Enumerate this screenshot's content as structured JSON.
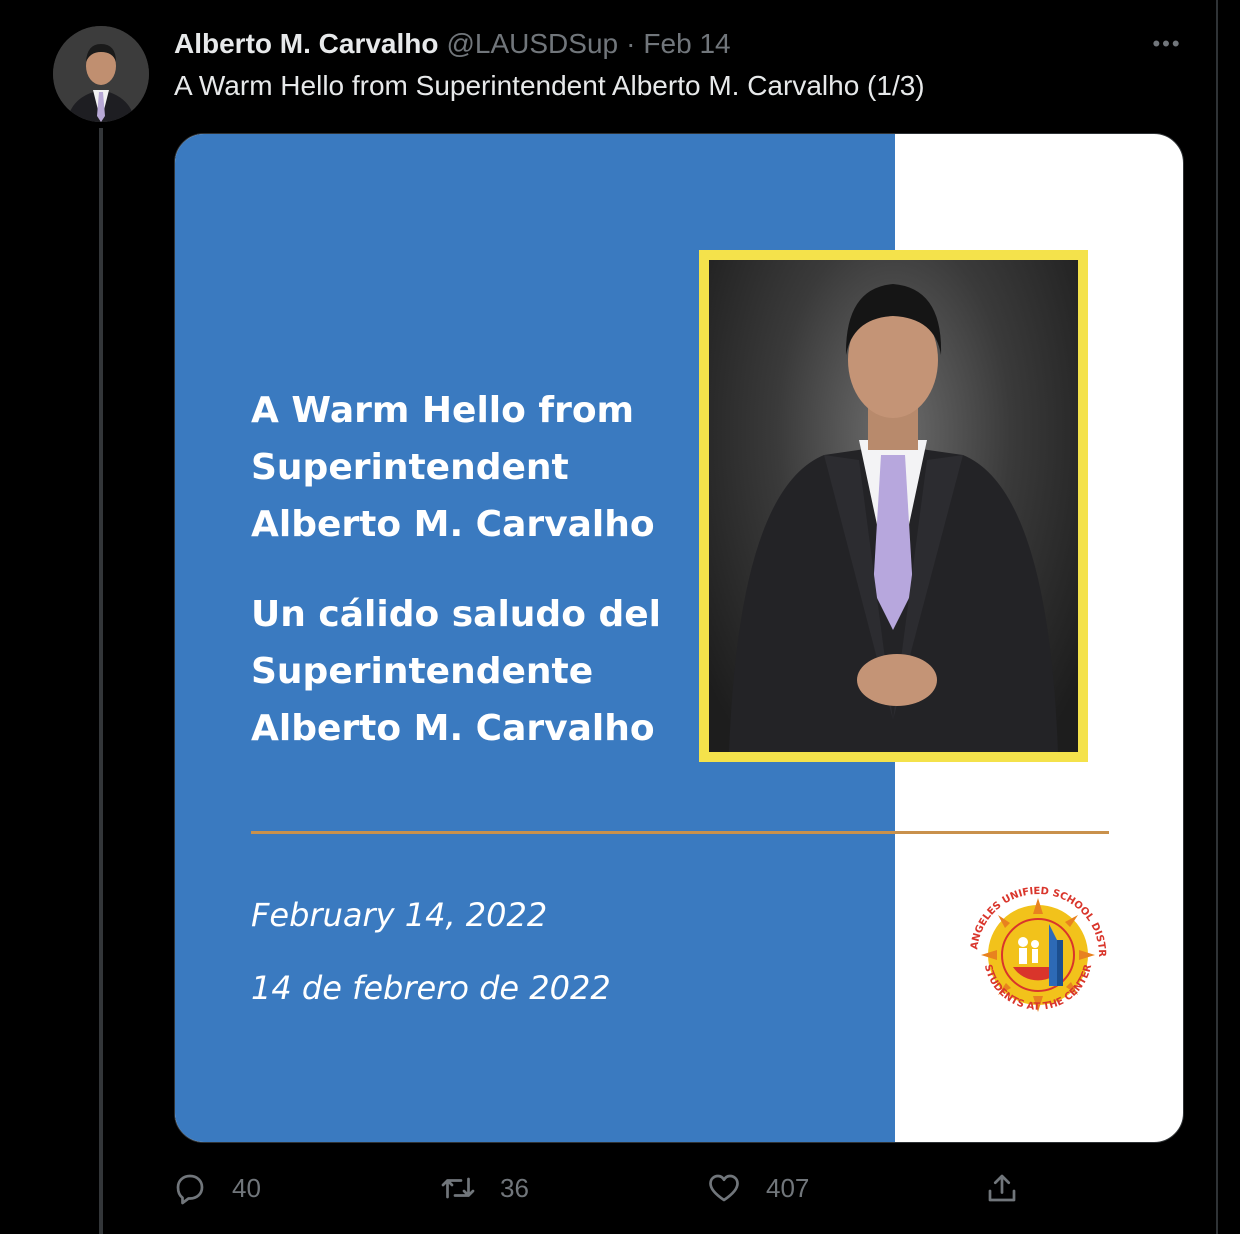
{
  "tweet": {
    "author_name": "Alberto M. Carvalho",
    "handle": "@LAUSDSup",
    "separator": "·",
    "date": "Feb 14",
    "more_label": "•••",
    "text": "A Warm Hello from Superintendent Alberto M. Carvalho (1/3)"
  },
  "media_card": {
    "english_lines": [
      "A Warm Hello from",
      "Superintendent",
      "Alberto M. Carvalho"
    ],
    "spanish_lines": [
      "Un cálido saludo del",
      "Superintendente",
      "Alberto M. Carvalho"
    ],
    "date_english": "February 14, 2022",
    "date_spanish": "14 de febrero de 2022",
    "logo_ring_top": "LOS ANGELES UNIFIED SCHOOL DISTRICT",
    "logo_ring_bottom": "STUDENTS AT THE CENTER",
    "colors": {
      "panel_blue": "#3a7ac0",
      "photo_frame": "#f4e24b",
      "divider": "#c9914c",
      "logo_red": "#d9352b",
      "logo_yellow": "#f2c21b"
    }
  },
  "actions": {
    "replies": "40",
    "retweets": "36",
    "likes": "407",
    "icons": [
      "reply-icon",
      "retweet-icon",
      "like-icon",
      "share-icon"
    ]
  }
}
